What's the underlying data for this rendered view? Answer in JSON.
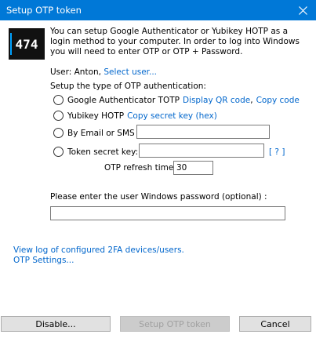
{
  "window": {
    "title": "Setup OTP token"
  },
  "logo": {
    "text": "474",
    "accent": "#00a2ff"
  },
  "description": "You can setup Google Authenticator or Yubikey HOTP as a login method to your computer. In order to log into Windows you will need to enter OTP or OTP + Password.",
  "user": {
    "prefix": "User: Anton,",
    "select_link": "Select user..."
  },
  "setup_label": "Setup the type of OTP authentication:",
  "options": {
    "google": {
      "label": "Google Authenticator TOTP",
      "link1": "Display QR code",
      "sep": ",",
      "link2": "Copy code"
    },
    "yubikey": {
      "label": "Yubikey HOTP",
      "link": "Copy secret key (hex)"
    },
    "email": {
      "label": "By Email or SMS :",
      "value": ""
    },
    "token": {
      "label": "Token secret key:",
      "value": "",
      "help": "[ ? ]"
    }
  },
  "refresh": {
    "label": "OTP refresh time:",
    "value": "30"
  },
  "password": {
    "label": "Please enter the user Windows password (optional) :",
    "value": ""
  },
  "links": {
    "view_log": "View log of configured 2FA devices/users.",
    "settings": "OTP Settings..."
  },
  "buttons": {
    "disable": "Disable...",
    "setup": "Setup OTP token",
    "cancel": "Cancel"
  },
  "colors": {
    "titlebar": "#0078d7",
    "link": "#0066cc"
  }
}
